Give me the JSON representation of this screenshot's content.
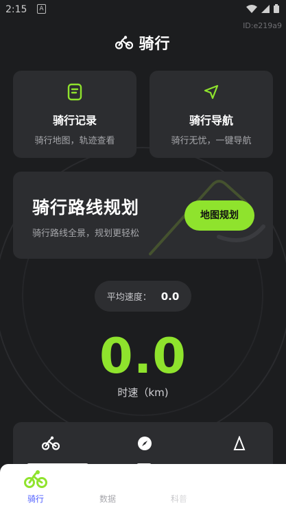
{
  "status_bar": {
    "time": "2:15",
    "notif_letter": "A"
  },
  "id_label": "ID:e219a9",
  "header": {
    "icon": "bicycle-icon",
    "title": "骑行"
  },
  "cards": {
    "record": {
      "icon": "document-icon",
      "title": "骑行记录",
      "subtitle": "骑行地图，轨迹查看"
    },
    "navigation": {
      "icon": "navigation-arrow-icon",
      "title": "骑行导航",
      "subtitle": "骑行无忧，一键导航"
    }
  },
  "route": {
    "title": "骑行路线规划",
    "subtitle": "骑行路线全景，规划更轻松",
    "button_label": "地图规划"
  },
  "average_speed": {
    "label": "平均速度：",
    "value": "0.0"
  },
  "current_speed": {
    "value": "0.0",
    "unit": "时速（km)"
  },
  "stats_icons": [
    "bicycle-icon",
    "compass-icon",
    "mountain-icon"
  ],
  "bottom_nav": [
    {
      "label": "骑行",
      "icon": "bicycle-icon",
      "active": true
    },
    {
      "label": "数据",
      "active": false
    },
    {
      "label": "科普",
      "active": false
    }
  ],
  "colors": {
    "accent": "#8fe32d",
    "background": "#1c1d1f",
    "card": "#2c2d30",
    "nav_active": "#4d5cff"
  }
}
